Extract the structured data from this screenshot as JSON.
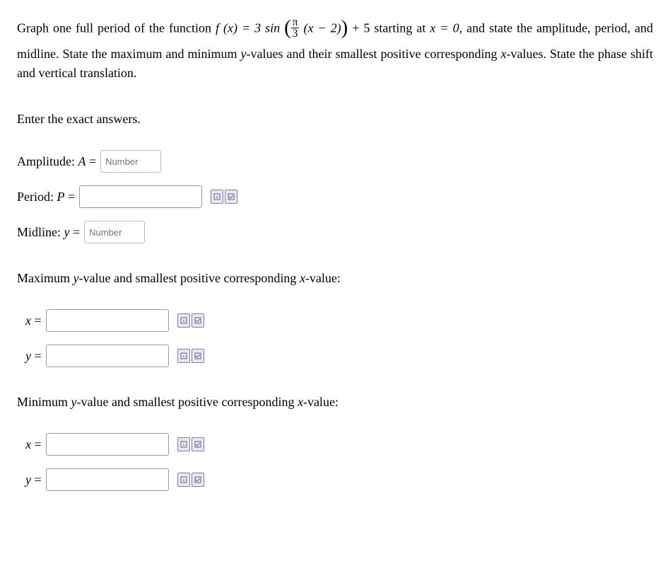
{
  "question": {
    "prefix": "Graph one full period of the function ",
    "func_lhs": "f (x) = 3 sin",
    "frac_num": "π",
    "frac_den": "3",
    "inner": "(x − 2)",
    "after_paren": " + 5",
    "mid": " starting at ",
    "start_cond": "x = 0",
    "tail1": ", and state the amplitude, period, and midline. State the maximum and minimum ",
    "yval": "y",
    "tail2": "-values and their smallest positive corresponding ",
    "xval": "x",
    "tail3": "-values. State the phase shift and vertical translation."
  },
  "instr": "Enter the exact answers.",
  "amplitude": {
    "label_pre": "Amplitude: ",
    "sym": "A",
    "eq": " = ",
    "placeholder": "Number"
  },
  "period": {
    "label_pre": "Period: ",
    "sym": "P",
    "eq": " = "
  },
  "midline": {
    "label_pre": "Midline: ",
    "sym": "y",
    "eq": " = ",
    "placeholder": "Number"
  },
  "max_prompt_pre": "Maximum ",
  "max_prompt_mid": "-value and smallest positive corresponding ",
  "max_prompt_end": "-value:",
  "min_prompt_pre": "Minimum ",
  "min_prompt_mid": "-value and smallest positive corresponding ",
  "min_prompt_end": "-value:",
  "xlabel": "x",
  "ylabel": "y",
  "equals": " ="
}
